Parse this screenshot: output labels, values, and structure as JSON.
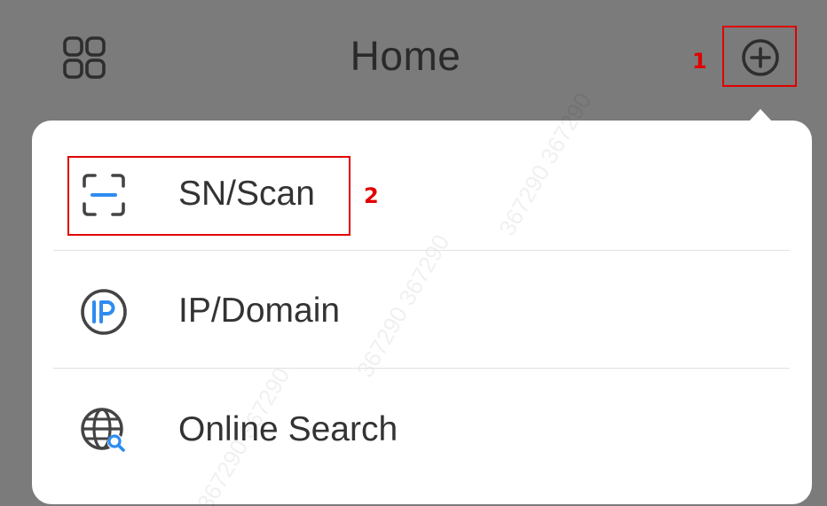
{
  "header": {
    "title": "Home",
    "grid_icon": "grid-icon",
    "add_icon": "plus-circle-icon"
  },
  "annotations": {
    "step1": "1",
    "step2": "2",
    "highlight_color": "#e00000"
  },
  "menu": {
    "items": [
      {
        "label": "SN/Scan",
        "icon": "scan-icon"
      },
      {
        "label": "IP/Domain",
        "icon": "ip-icon"
      },
      {
        "label": "Online Search",
        "icon": "globe-search-icon"
      }
    ]
  },
  "colors": {
    "overlay_background": "#7b7b7b",
    "menu_background": "#ffffff",
    "icon_gray": "#444444",
    "icon_blue": "#2f8cf0",
    "text": "#333333",
    "divider": "#e2e2e2"
  }
}
